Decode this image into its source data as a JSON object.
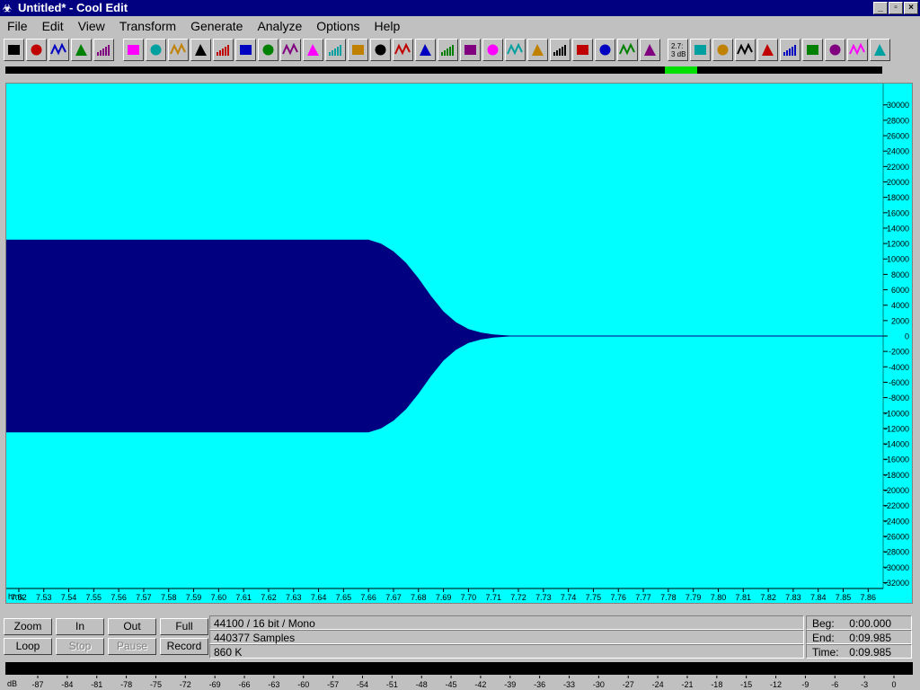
{
  "window": {
    "title": "Untitled* - Cool Edit",
    "buttons": [
      "_",
      "▫",
      "×"
    ]
  },
  "menu": [
    "File",
    "Edit",
    "View",
    "Transform",
    "Generate",
    "Analyze",
    "Options",
    "Help"
  ],
  "toolbar": {
    "button_count": 39,
    "icons": [
      "new-icon",
      "open-icon",
      "save-icon",
      "save-selection-icon",
      "headphones-icon",
      "rewind-icon",
      "stop-bar-icon",
      "loop-arrows-icon",
      "note-icon",
      "record-dot-icon",
      "noise-icon",
      "amplify-icon",
      "envelope-icon",
      "equalize-icon",
      "stopwatch-icon",
      "echo-icon",
      "delay-icon",
      "reverse-icon",
      "spectrum-icon",
      "wave-icon",
      "bar-spectrum-icon",
      "no-noise-icon",
      "filter-icon",
      "distortion-icon",
      "stretch-icon",
      "scripts-icon",
      "brainwave-icon",
      "dynamics-icon",
      "wave-synth-icon",
      "normalize-3db-icon",
      "cd-icon",
      "help-icon",
      "arrow-right-icon",
      "cue-list-icon",
      "frequency-icon",
      "zoom-magnify-icon",
      "insert-icon",
      "notepad-icon",
      "settings-icon"
    ],
    "normalize_label": [
      "2.7:",
      "3 dB"
    ]
  },
  "waveform": {
    "format": "44100 / 16 bit / Mono",
    "samples": "440377 Samples",
    "size": "860 K",
    "colors": {
      "background": "#00ffff",
      "wave": "#000080"
    }
  },
  "chart_data": {
    "type": "area",
    "x_unit_label": "hms",
    "x_ticks": [
      "7.52",
      "7.53",
      "7.54",
      "7.55",
      "7.56",
      "7.57",
      "7.58",
      "7.59",
      "7.60",
      "7.61",
      "7.62",
      "7.63",
      "7.64",
      "7.65",
      "7.66",
      "7.67",
      "7.68",
      "7.69",
      "7.70",
      "7.71",
      "7.72",
      "7.73",
      "7.74",
      "7.75",
      "7.76",
      "7.77",
      "7.78",
      "7.79",
      "7.80",
      "7.81",
      "7.82",
      "7.83",
      "7.84",
      "7.85",
      "7.86"
    ],
    "y_ticks": [
      "30000",
      "28000",
      "26000",
      "24000",
      "22000",
      "20000",
      "18000",
      "16000",
      "14000",
      "12000",
      "10000",
      "8000",
      "6000",
      "4000",
      "2000",
      "0",
      "-2000",
      "-4000",
      "-6000",
      "-8000",
      "-10000",
      "-12000",
      "-14000",
      "-16000",
      "-18000",
      "-20000",
      "-22000",
      "-24000",
      "-26000",
      "-28000",
      "-30000",
      "-32000"
    ],
    "ylim": [
      -32768,
      32767
    ],
    "envelope": {
      "x": [
        7.515,
        7.66,
        7.665,
        7.67,
        7.675,
        7.68,
        7.685,
        7.69,
        7.695,
        7.7,
        7.705,
        7.71,
        7.715,
        7.72,
        7.866
      ],
      "amplitude": [
        12500,
        12500,
        12000,
        11000,
        9500,
        7500,
        5200,
        3200,
        1800,
        900,
        450,
        200,
        80,
        0,
        0
      ]
    }
  },
  "controls": {
    "row1": [
      "Zoom",
      "In",
      "Out",
      "Full"
    ],
    "row2": [
      "Loop",
      "Stop",
      "Pause",
      "Record"
    ],
    "disabled": [
      "Stop",
      "Pause"
    ]
  },
  "time": {
    "beg_label": "Beg:",
    "beg": "0:00.000",
    "end_label": "End:",
    "end": "0:09.985",
    "time_label": "Time:",
    "time": "0:09.985"
  },
  "meter": {
    "db_label": "dB",
    "ticks": [
      "-87",
      "-84",
      "-81",
      "-78",
      "-75",
      "-72",
      "-69",
      "-66",
      "-63",
      "-60",
      "-57",
      "-54",
      "-51",
      "-48",
      "-45",
      "-42",
      "-39",
      "-36",
      "-33",
      "-30",
      "-27",
      "-24",
      "-21",
      "-18",
      "-15",
      "-12",
      "-9",
      "-6",
      "-3",
      "0"
    ]
  }
}
